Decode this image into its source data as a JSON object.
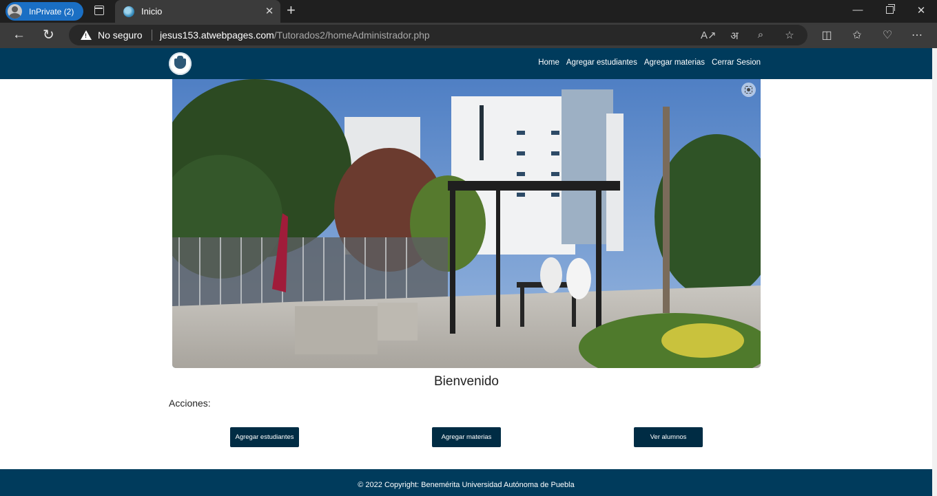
{
  "browser": {
    "profile_label": "InPrivate (2)",
    "tab_title": "Inicio",
    "tab_close": "✕",
    "new_tab": "+",
    "security_label": "No seguro",
    "url_host": "jesus153.atwebpages.com",
    "url_path": "/Tutorados2/homeAdministrador.php",
    "window_controls": {
      "minimize": "—",
      "close": "✕"
    }
  },
  "site": {
    "menu": [
      "Home",
      "Agregar estudiantes",
      "Agregar materias",
      "Cerrar Sesion"
    ],
    "welcome_title": "Bienvenido",
    "actions_label": "Acciones:",
    "buttons": [
      "Agregar estudiantes",
      "Agregar materias",
      "Ver alumnos"
    ],
    "footer": "© 2022 Copyright: Benemérita Universidad Autónoma de Puebla"
  },
  "colors": {
    "nav_bg": "#003b5c",
    "button_bg": "#002c44",
    "footer_bg": "#003b5c"
  }
}
